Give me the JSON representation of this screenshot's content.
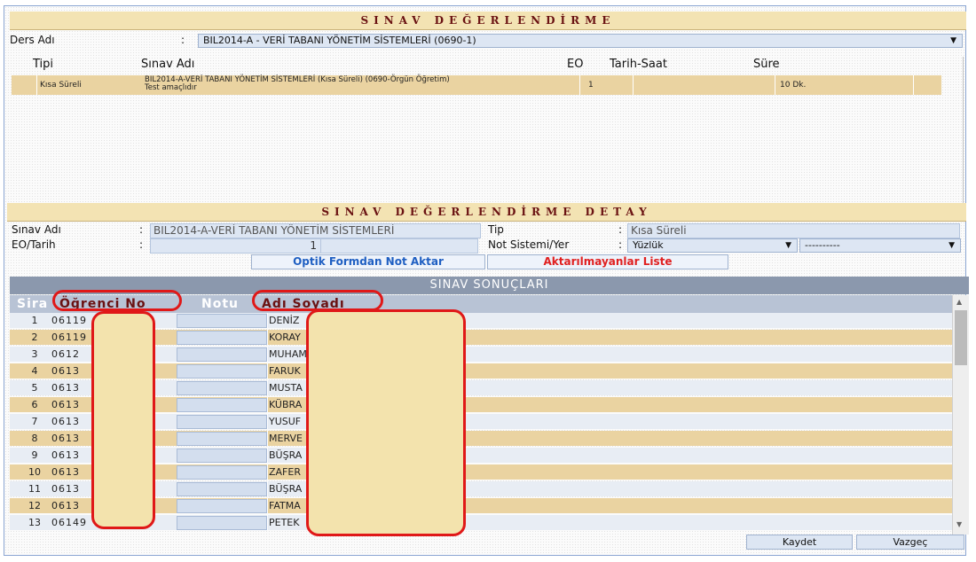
{
  "header": {
    "title": "SINAV DEĞERLENDİRME"
  },
  "course": {
    "label": "Ders Adı",
    "colon": ":",
    "selected": "BIL2014-A - VERİ TABANI YÖNETİM SİSTEMLERİ (0690-1)"
  },
  "exam_table": {
    "columns": [
      "Tipi",
      "Sınav Adı",
      "EO",
      "Tarih-Saat",
      "Süre"
    ],
    "rows": [
      {
        "type": "Kısa Süreli",
        "name_line1": "BIL2014-A-VERİ TABANI YÖNETİM SİSTEMLERİ (Kısa Süreli) (0690-Örgün Öğretim)",
        "name_line2": "Test amaçlıdır",
        "eo": "1",
        "datetime": "",
        "duration": "10 Dk."
      }
    ]
  },
  "detail": {
    "title": "SINAV DEĞERLENDİRME DETAY",
    "exam_name_label": "Sınav Adı",
    "exam_name_value": "BIL2014-A-VERİ TABANI YÖNETİM SİSTEMLERİ",
    "eo_date_label": "EO/Tarih",
    "eo_value": "1",
    "date_value": "",
    "type_label": "Tip",
    "type_value": "Kısa Süreli",
    "grade_system_label": "Not Sistemi/Yer",
    "grade_system_value": "Yüzlük",
    "place_value": "----------",
    "colon": ":"
  },
  "actions": {
    "optik_button": "Optik Formdan Not Aktar",
    "failed_list_button": "Aktarılmayanlar Liste"
  },
  "results": {
    "title": "SINAV SONUÇLARI",
    "columns": {
      "sira": "Sira",
      "student_no": "Öğrenci No",
      "grade": "Notu",
      "name": "Adı Soyadı"
    },
    "rows": [
      {
        "sira": "1",
        "student_no": "06119",
        "name": "DENİZ",
        "bg": "#e8edf4"
      },
      {
        "sira": "2",
        "student_no": "06119",
        "name": "KORAY",
        "bg": "#ead3a1"
      },
      {
        "sira": "3",
        "student_no": "0612",
        "name": "MUHAM",
        "bg": "#e8edf4"
      },
      {
        "sira": "4",
        "student_no": "0613",
        "name": "FARUK",
        "bg": "#ead3a1"
      },
      {
        "sira": "5",
        "student_no": "0613",
        "name": "MUSTA",
        "bg": "#e8edf4"
      },
      {
        "sira": "6",
        "student_no": "0613",
        "name": "KÜBRA",
        "bg": "#ead3a1"
      },
      {
        "sira": "7",
        "student_no": "0613",
        "name": "YUSUF",
        "bg": "#e8edf4"
      },
      {
        "sira": "8",
        "student_no": "0613",
        "name": "MERVE",
        "bg": "#ead3a1"
      },
      {
        "sira": "9",
        "student_no": "0613",
        "name": "BÜŞRA",
        "bg": "#e8edf4"
      },
      {
        "sira": "10",
        "student_no": "0613",
        "name": "ZAFER",
        "bg": "#ead3a1"
      },
      {
        "sira": "11",
        "student_no": "0613",
        "name": "BÜŞRA",
        "bg": "#e8edf4"
      },
      {
        "sira": "12",
        "student_no": "0613",
        "name": "FATMA",
        "bg": "#ead3a1"
      },
      {
        "sira": "13",
        "student_no": "06149",
        "name": "PETEK",
        "bg": "#e8edf4"
      }
    ]
  },
  "footer": {
    "save": "Kaydet",
    "cancel": "Vazgeç"
  },
  "colors": {
    "title_text": "#6a1212",
    "row_tan": "#ead3a1",
    "row_blue": "#e8edf4",
    "blue_button_text": "#1f5fc2",
    "red_button_text": "#e02020",
    "annotation_red": "#e01818"
  }
}
